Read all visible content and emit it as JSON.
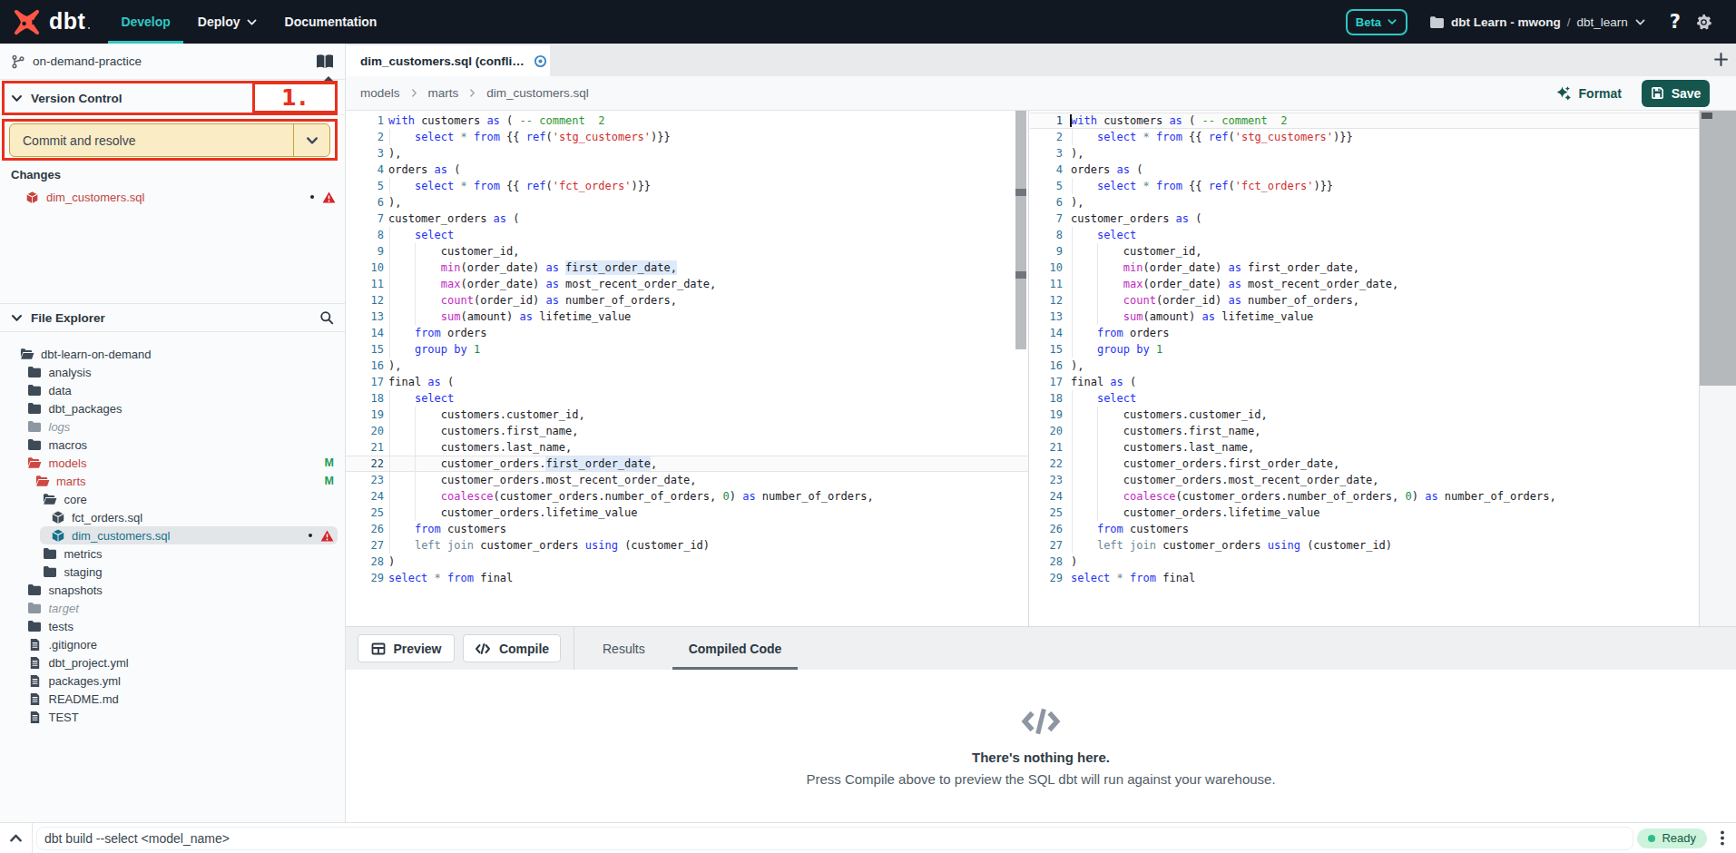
{
  "topnav": {
    "brand": "dbt",
    "menu": [
      {
        "label": "Develop",
        "active": true,
        "chevron": false
      },
      {
        "label": "Deploy",
        "active": false,
        "chevron": true
      },
      {
        "label": "Documentation",
        "active": false,
        "chevron": false
      }
    ],
    "beta_label": "Beta",
    "account_name": "dbt Learn - mwong",
    "separator": "/",
    "project_name": "dbt_learn",
    "help_label": "?"
  },
  "sidebar": {
    "branch_name": "on-demand-practice",
    "version_control_title": "Version Control",
    "commit_button_label": "Commit and resolve",
    "changes_title": "Changes",
    "changed_files": [
      {
        "name": "dim_customers.sql",
        "modified": true,
        "warning": true
      }
    ],
    "file_explorer_title": "File Explorer",
    "tree": [
      {
        "label": "dbt-learn-on-demand",
        "depth": 0,
        "icon": "folder-open",
        "style": "normal"
      },
      {
        "label": "analysis",
        "depth": 1,
        "icon": "folder",
        "style": "normal"
      },
      {
        "label": "data",
        "depth": 1,
        "icon": "folder",
        "style": "normal"
      },
      {
        "label": "dbt_packages",
        "depth": 1,
        "icon": "folder",
        "style": "normal"
      },
      {
        "label": "logs",
        "depth": 1,
        "icon": "folder",
        "style": "muted"
      },
      {
        "label": "macros",
        "depth": 1,
        "icon": "folder",
        "style": "normal"
      },
      {
        "label": "models",
        "depth": 1,
        "icon": "folder-open",
        "style": "red",
        "badge": "M"
      },
      {
        "label": "marts",
        "depth": 2,
        "icon": "folder-open",
        "style": "red",
        "badge": "M"
      },
      {
        "label": "core",
        "depth": 3,
        "icon": "folder-open",
        "style": "normal"
      },
      {
        "label": "fct_orders.sql",
        "depth": 4,
        "icon": "model",
        "style": "normal"
      },
      {
        "label": "dim_customers.sql",
        "depth": 4,
        "icon": "model",
        "style": "selected",
        "selected": true,
        "dot": true,
        "warning": true
      },
      {
        "label": "metrics",
        "depth": 3,
        "icon": "folder",
        "style": "normal"
      },
      {
        "label": "staging",
        "depth": 3,
        "icon": "folder",
        "style": "normal"
      },
      {
        "label": "snapshots",
        "depth": 1,
        "icon": "folder",
        "style": "normal"
      },
      {
        "label": "target",
        "depth": 1,
        "icon": "folder",
        "style": "muted"
      },
      {
        "label": "tests",
        "depth": 1,
        "icon": "folder",
        "style": "normal"
      },
      {
        "label": ".gitignore",
        "depth": 1,
        "icon": "file",
        "style": "normal"
      },
      {
        "label": "dbt_project.yml",
        "depth": 1,
        "icon": "file",
        "style": "normal"
      },
      {
        "label": "packages.yml",
        "depth": 1,
        "icon": "file",
        "style": "normal"
      },
      {
        "label": "README.md",
        "depth": 1,
        "icon": "file",
        "style": "normal"
      },
      {
        "label": "TEST",
        "depth": 1,
        "icon": "file",
        "style": "normal"
      }
    ]
  },
  "annotation": {
    "step_label": "1.",
    "color": "#e8311c"
  },
  "editor_tab_title": "dim_customers.sql (confli…",
  "breadcrumb": [
    "models",
    "marts",
    "dim_customers.sql"
  ],
  "toolbar": {
    "format_label": "Format",
    "save_label": "Save"
  },
  "code": {
    "lines": [
      [
        [
          "k",
          "with"
        ],
        [
          "t",
          " customers "
        ],
        [
          "k",
          "as"
        ],
        [
          "t",
          " ( "
        ],
        [
          "c",
          "-- comment  2"
        ]
      ],
      [
        [
          "t",
          "    "
        ],
        [
          "k",
          "select"
        ],
        [
          "t",
          " "
        ],
        [
          "o",
          "*"
        ],
        [
          "t",
          " "
        ],
        [
          "k",
          "from"
        ],
        [
          "t",
          " {{ "
        ],
        [
          "k",
          "ref"
        ],
        [
          "t",
          "("
        ],
        [
          "s",
          "'stg_customers'"
        ],
        [
          "t",
          ")}}"
        ]
      ],
      [
        [
          "t",
          "),"
        ]
      ],
      [
        [
          "t",
          "orders "
        ],
        [
          "k",
          "as"
        ],
        [
          "t",
          " ("
        ]
      ],
      [
        [
          "t",
          "    "
        ],
        [
          "k",
          "select"
        ],
        [
          "t",
          " "
        ],
        [
          "o",
          "*"
        ],
        [
          "t",
          " "
        ],
        [
          "k",
          "from"
        ],
        [
          "t",
          " {{ "
        ],
        [
          "k",
          "ref"
        ],
        [
          "t",
          "("
        ],
        [
          "s",
          "'fct_orders'"
        ],
        [
          "t",
          ")}}"
        ]
      ],
      [
        [
          "t",
          "),"
        ]
      ],
      [
        [
          "t",
          "customer_orders "
        ],
        [
          "k",
          "as"
        ],
        [
          "t",
          " ("
        ]
      ],
      [
        [
          "t",
          "    "
        ],
        [
          "k",
          "select"
        ]
      ],
      [
        [
          "t",
          "        customer_id,"
        ]
      ],
      [
        [
          "t",
          "        "
        ],
        [
          "f",
          "min"
        ],
        [
          "t",
          "(order_date) "
        ],
        [
          "k",
          "as"
        ],
        [
          "t",
          " first_order_date,"
        ]
      ],
      [
        [
          "t",
          "        "
        ],
        [
          "f",
          "max"
        ],
        [
          "t",
          "(order_date) "
        ],
        [
          "k",
          "as"
        ],
        [
          "t",
          " most_recent_order_date,"
        ]
      ],
      [
        [
          "t",
          "        "
        ],
        [
          "f",
          "count"
        ],
        [
          "t",
          "(order_id) "
        ],
        [
          "k",
          "as"
        ],
        [
          "t",
          " number_of_orders,"
        ]
      ],
      [
        [
          "t",
          "        "
        ],
        [
          "f",
          "sum"
        ],
        [
          "t",
          "(amount) "
        ],
        [
          "k",
          "as"
        ],
        [
          "t",
          " lifetime_value"
        ]
      ],
      [
        [
          "t",
          "    "
        ],
        [
          "k",
          "from"
        ],
        [
          "t",
          " orders"
        ]
      ],
      [
        [
          "t",
          "    "
        ],
        [
          "k",
          "group"
        ],
        [
          "t",
          " "
        ],
        [
          "k",
          "by"
        ],
        [
          "t",
          " "
        ],
        [
          "n",
          "1"
        ]
      ],
      [
        [
          "t",
          "),"
        ]
      ],
      [
        [
          "t",
          "final "
        ],
        [
          "k",
          "as"
        ],
        [
          "t",
          " ("
        ]
      ],
      [
        [
          "t",
          "    "
        ],
        [
          "k",
          "select"
        ]
      ],
      [
        [
          "t",
          "        customers.customer_id,"
        ]
      ],
      [
        [
          "t",
          "        customers.first_name,"
        ]
      ],
      [
        [
          "t",
          "        customers.last_name,"
        ]
      ],
      [
        [
          "t",
          "        customer_orders.first_order_date,"
        ]
      ],
      [
        [
          "t",
          "        customer_orders.most_recent_order_date,"
        ]
      ],
      [
        [
          "t",
          "        "
        ],
        [
          "f",
          "coalesce"
        ],
        [
          "t",
          "(customer_orders.number_of_orders, "
        ],
        [
          "n",
          "0"
        ],
        [
          "t",
          ") "
        ],
        [
          "k",
          "as"
        ],
        [
          "t",
          " number_of_orders,"
        ]
      ],
      [
        [
          "t",
          "        customer_orders.lifetime_value"
        ]
      ],
      [
        [
          "t",
          "    "
        ],
        [
          "k",
          "from"
        ],
        [
          "t",
          " customers"
        ]
      ],
      [
        [
          "t",
          "    "
        ],
        [
          "o",
          "left"
        ],
        [
          "t",
          " "
        ],
        [
          "o",
          "join"
        ],
        [
          "t",
          " customer_orders "
        ],
        [
          "k",
          "using"
        ],
        [
          "t",
          " (customer_id)"
        ]
      ],
      [
        [
          "t",
          ")"
        ]
      ],
      [
        [
          "k",
          "select"
        ],
        [
          "t",
          " "
        ],
        [
          "o",
          "*"
        ],
        [
          "t",
          " "
        ],
        [
          "k",
          "from"
        ],
        [
          "t",
          " final"
        ]
      ]
    ],
    "left_pane": {
      "active_line": 22,
      "highlights": [
        {
          "line": 10,
          "col": 27,
          "len": 17
        },
        {
          "line": 22,
          "col": 24,
          "len": 16
        }
      ],
      "cursor": null
    },
    "right_pane": {
      "active_line": 1,
      "highlights": [],
      "cursor": {
        "line": 1,
        "col": 0
      }
    }
  },
  "bottom_panel": {
    "preview_label": "Preview",
    "compile_label": "Compile",
    "tabs": [
      {
        "label": "Results",
        "active": false
      },
      {
        "label": "Compiled Code",
        "active": true
      }
    ],
    "empty_title": "There's nothing here.",
    "empty_desc": "Press Compile above to preview the SQL dbt will run against your warehouse."
  },
  "command_bar": {
    "command": "dbt build --select <model_name>",
    "status_label": "Ready",
    "status_color": "#2ebd8a"
  }
}
